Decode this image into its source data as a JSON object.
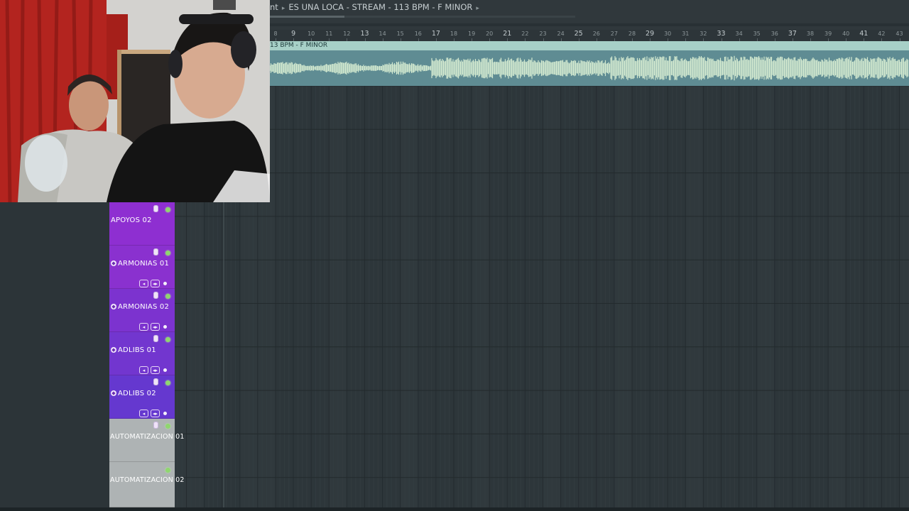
{
  "titlebar": {
    "breadcrumb_prefix": "nt",
    "project_title": "ES UNA LOCA - STREAM - 113 BPM - F MINOR"
  },
  "ruler": {
    "major_bars": [
      "9",
      "13",
      "17",
      "21",
      "25",
      "29",
      "33",
      "37",
      "41"
    ],
    "minor_bars": [
      "8",
      "10",
      "11",
      "12",
      "14",
      "15",
      "16",
      "18",
      "19",
      "20",
      "22",
      "23",
      "24",
      "26",
      "27",
      "28",
      "30",
      "31",
      "32",
      "34",
      "35",
      "36",
      "38",
      "39",
      "40",
      "42",
      "43"
    ]
  },
  "clip": {
    "label": "13 BPM - F MINOR",
    "colors": {
      "header": "#a7d0c7",
      "body": "#5f8c93",
      "wave": "#d4ead0"
    }
  },
  "tracks": [
    {
      "name": "APOYOS 02",
      "color": "#8e2fd1",
      "show_pin": false,
      "show_buttons": false
    },
    {
      "name": "ARMONIAS 01",
      "color": "#8a31cf",
      "show_pin": true,
      "show_buttons": true
    },
    {
      "name": "ARMONIAS 02",
      "color": "#7c33cf",
      "show_pin": true,
      "show_buttons": true
    },
    {
      "name": "ADLIBS 01",
      "color": "#7236cf",
      "show_pin": true,
      "show_buttons": true
    },
    {
      "name": "ADLIBS 02",
      "color": "#6538cf",
      "show_pin": true,
      "show_buttons": true
    },
    {
      "name": "AUTOMATIZACION 01",
      "color": "#aeb3b4",
      "show_pin": false,
      "show_buttons": false
    },
    {
      "name": "AUTOMATIZACION 02",
      "color": "#aeb3b4",
      "show_pin": false,
      "show_buttons": false
    }
  ],
  "colors": {
    "grid_background": "#30393d",
    "accent_led": "#8fd66f"
  }
}
